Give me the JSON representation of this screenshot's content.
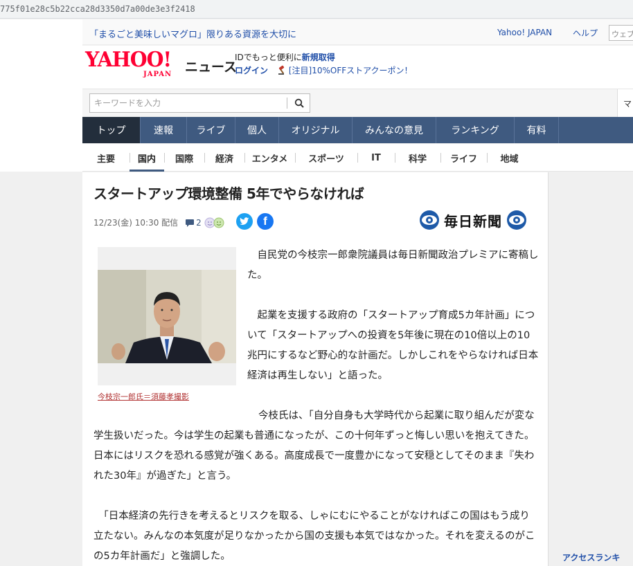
{
  "browser": {
    "url": "775f01e28c5b22cca28d3350d7a00de3e3f2418"
  },
  "topbar": {
    "promo": "「まるごと美味しいマグロ」限りある資源を大切に",
    "yahoo_japan": "Yahoo! JAPAN",
    "help": "ヘルプ",
    "web_search": "ウェブ"
  },
  "header": {
    "logo_main": "YAHOO!",
    "logo_sub": "JAPAN",
    "logo_news": "ニュース",
    "id_prefix": "IDでもっと便利に",
    "id_link": "新規取得",
    "login": "ログイン",
    "coupon": "[注目]10%OFFストアクーポン！"
  },
  "search": {
    "placeholder": "キーワードを入力",
    "right_box": "マ"
  },
  "nav_main": {
    "items": [
      "トップ",
      "速報",
      "ライブ",
      "個人",
      "オリジナル",
      "みんなの意見",
      "ランキング",
      "有料"
    ],
    "active": "トップ"
  },
  "nav_sub": {
    "items": [
      "主要",
      "国内",
      "国際",
      "経済",
      "エンタメ",
      "スポーツ",
      "IT",
      "科学",
      "ライフ",
      "地域"
    ],
    "active": "国内"
  },
  "article": {
    "title": "スタートアップ環境整備 5年でやらなければ",
    "date": "12/23(金) 10:30 配信",
    "comments": "2",
    "publisher": "毎日新聞",
    "caption": "今枝宗一郎氏＝須藤孝撮影",
    "paragraphs": [
      "　自民党の今枝宗一郎衆院議員は毎日新聞政治プレミアに寄稿した。",
      "　起業を支援する政府の「スタートアップ育成5カ年計画」について「スタートアップへの投資を5年後に現在の10倍以上の10兆円にするなど野心的な計画だ。しかしこれをやらなければ日本経済は再生しない」と語った。",
      "今枝氏は、「自分自身も大学時代から起業に取り組んだが変な学生扱いだった。今は学生の起業も普通になったが、この十何年ずっと悔しい思いを抱えてきた。日本にはリスクを恐れる感覚が強くある。高度成長で一度豊かになって安穏としてそのまま『失われた30年』が過ぎた」と言う。",
      "　「日本経済の先行きを考えるとリスクを取る、しゃにむにやることがなければこの国はもう成り立たない。みんなの本気度が足りなかったから国の支援も本気ではなかった。それを変えるのがこの5カ年計画だ」と強調した。"
    ]
  },
  "sidebar": {
    "access_ranking": "アクセスランキ"
  },
  "colors": {
    "nav": "#3f5a80",
    "nav_active": "#232e3c",
    "link": "#1f4ea8",
    "brand": "#ff0033",
    "caption": "#b03030"
  }
}
